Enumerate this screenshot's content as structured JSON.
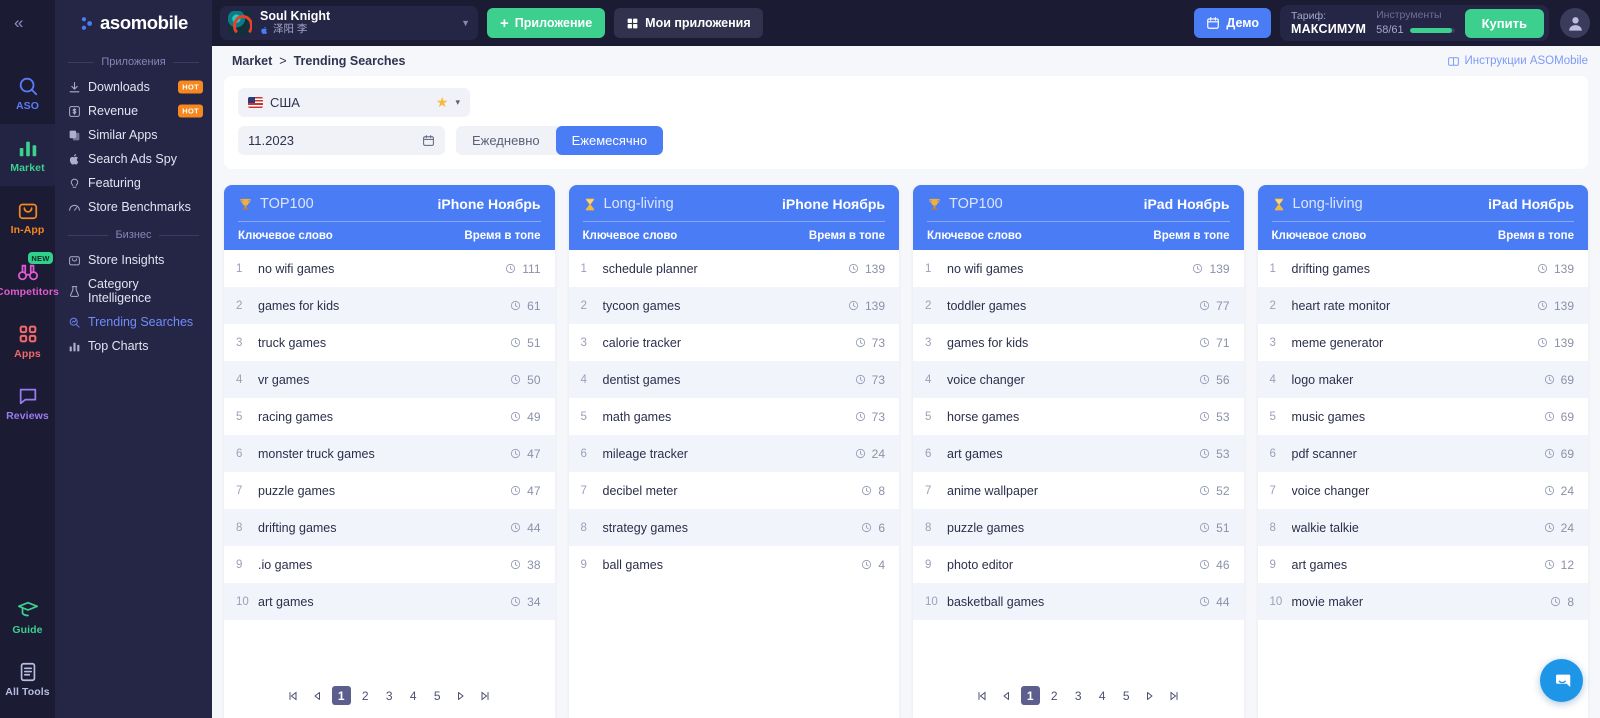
{
  "rail": {
    "collapse_icon": "chevron-double-left",
    "items": [
      {
        "label": "ASO",
        "icon": "search-icon",
        "color": "#5b7cf5",
        "active": false
      },
      {
        "label": "Market",
        "icon": "bar-chart-icon",
        "color": "#3ccf8e",
        "active": true
      },
      {
        "label": "In-App",
        "icon": "bag-icon",
        "color": "#f7881f",
        "active": false
      },
      {
        "label": "Competitors",
        "icon": "binoculars-icon",
        "color": "#e05bd0",
        "active": false,
        "badge": "NEW"
      },
      {
        "label": "Apps",
        "icon": "grid-icon",
        "color": "#f26a6a",
        "active": false
      },
      {
        "label": "Reviews",
        "icon": "chat-icon",
        "color": "#9a7bf0",
        "active": false
      }
    ],
    "bottom_items": [
      {
        "label": "Guide",
        "icon": "graduation-cap-icon",
        "color": "#3ccf8e"
      },
      {
        "label": "All Tools",
        "icon": "document-icon",
        "color": "#b9bee0"
      }
    ]
  },
  "sidebar": {
    "brand": "asomobile",
    "group1_label": "Приложения",
    "group1": [
      {
        "label": "Downloads",
        "icon": "download-icon",
        "badge": "HOT",
        "active": false
      },
      {
        "label": "Revenue",
        "icon": "dollar-icon",
        "badge": "HOT",
        "active": false
      },
      {
        "label": "Similar Apps",
        "icon": "copy-icon",
        "active": false
      },
      {
        "label": "Search Ads Spy",
        "icon": "apple-icon",
        "active": false
      },
      {
        "label": "Featuring",
        "icon": "lightbulb-icon",
        "active": false
      },
      {
        "label": "Store Benchmarks",
        "icon": "speedometer-icon",
        "active": false
      }
    ],
    "group2_label": "Бизнес",
    "group2": [
      {
        "label": "Store Insights",
        "icon": "store-icon",
        "active": false
      },
      {
        "label": "Category Intelligence",
        "icon": "flask-icon",
        "active": false
      },
      {
        "label": "Trending Searches",
        "icon": "search-trend-icon",
        "active": true
      },
      {
        "label": "Top Charts",
        "icon": "bar-chart-icon",
        "active": false
      }
    ]
  },
  "topbar": {
    "app_name": "Soul Knight",
    "app_developer": "泽阳 李",
    "app_platform_icon": "apple-icon",
    "add_app_label": "Приложение",
    "add_app_icon": "plus-icon",
    "my_apps_label": "Мои приложения",
    "my_apps_icon": "grid-icon",
    "demo_label": "Демо",
    "demo_icon": "calendar-icon",
    "plan_title": "Тариф:",
    "plan_value": "МАКСИМУМ",
    "tools_title": "Инструменты",
    "tools_value": "58/61",
    "tools_percent": 95,
    "buy_label": "Купить",
    "avatar_icon": "user-icon",
    "accent_green": "#3ccf8e",
    "accent_blue": "#4a7cf5"
  },
  "breadcrumb": {
    "root": "Market",
    "separator": ">",
    "current": "Trending Searches",
    "instructions_label": "Инструкции ASOMobile",
    "instructions_icon": "book-icon"
  },
  "filters": {
    "country": "США",
    "country_flag_icon": "us-flag-icon",
    "favorite_icon": "star-icon",
    "dropdown_icon": "chevron-down-icon",
    "date_value": "11.2023",
    "date_icon": "calendar-icon",
    "period_daily": "Ежедневно",
    "period_monthly": "Ежемесячно",
    "period_selected": "Ежемесячно"
  },
  "table_columns": {
    "keyword": "Ключевое слово",
    "time": "Время в топе"
  },
  "cards": [
    {
      "title": "TOP100",
      "title_icon": "trophy-icon",
      "device": "iPhone Ноябрь",
      "has_pager": true,
      "rows": [
        {
          "rank": "1",
          "keyword": "no wifi games",
          "time": "111"
        },
        {
          "rank": "2",
          "keyword": "games for kids",
          "time": "61"
        },
        {
          "rank": "3",
          "keyword": "truck games",
          "time": "51"
        },
        {
          "rank": "4",
          "keyword": "vr games",
          "time": "50"
        },
        {
          "rank": "5",
          "keyword": "racing games",
          "time": "49"
        },
        {
          "rank": "6",
          "keyword": "monster truck games",
          "time": "47"
        },
        {
          "rank": "7",
          "keyword": "puzzle games",
          "time": "47"
        },
        {
          "rank": "8",
          "keyword": "drifting games",
          "time": "44"
        },
        {
          "rank": "9",
          "keyword": ".io games",
          "time": "38"
        },
        {
          "rank": "10",
          "keyword": "art games",
          "time": "34"
        }
      ]
    },
    {
      "title": "Long-living",
      "title_icon": "hourglass-icon",
      "device": "iPhone Ноябрь",
      "has_pager": false,
      "rows": [
        {
          "rank": "1",
          "keyword": "schedule planner",
          "time": "139"
        },
        {
          "rank": "2",
          "keyword": "tycoon games",
          "time": "139"
        },
        {
          "rank": "3",
          "keyword": "calorie tracker",
          "time": "73"
        },
        {
          "rank": "4",
          "keyword": "dentist games",
          "time": "73"
        },
        {
          "rank": "5",
          "keyword": "math games",
          "time": "73"
        },
        {
          "rank": "6",
          "keyword": "mileage tracker",
          "time": "24"
        },
        {
          "rank": "7",
          "keyword": "decibel meter",
          "time": "8"
        },
        {
          "rank": "8",
          "keyword": "strategy games",
          "time": "6"
        },
        {
          "rank": "9",
          "keyword": "ball games",
          "time": "4"
        }
      ]
    },
    {
      "title": "TOP100",
      "title_icon": "trophy-icon",
      "device": "iPad Ноябрь",
      "has_pager": true,
      "rows": [
        {
          "rank": "1",
          "keyword": "no wifi games",
          "time": "139"
        },
        {
          "rank": "2",
          "keyword": "toddler games",
          "time": "77"
        },
        {
          "rank": "3",
          "keyword": "games for kids",
          "time": "71"
        },
        {
          "rank": "4",
          "keyword": "voice changer",
          "time": "56"
        },
        {
          "rank": "5",
          "keyword": "horse games",
          "time": "53"
        },
        {
          "rank": "6",
          "keyword": "art games",
          "time": "53"
        },
        {
          "rank": "7",
          "keyword": "anime wallpaper",
          "time": "52"
        },
        {
          "rank": "8",
          "keyword": "puzzle games",
          "time": "51"
        },
        {
          "rank": "9",
          "keyword": "photo editor",
          "time": "46"
        },
        {
          "rank": "10",
          "keyword": "basketball games",
          "time": "44"
        }
      ]
    },
    {
      "title": "Long-living",
      "title_icon": "hourglass-icon",
      "device": "iPad Ноябрь",
      "has_pager": false,
      "rows": [
        {
          "rank": "1",
          "keyword": "drifting games",
          "time": "139"
        },
        {
          "rank": "2",
          "keyword": "heart rate monitor",
          "time": "139"
        },
        {
          "rank": "3",
          "keyword": "meme generator",
          "time": "139"
        },
        {
          "rank": "4",
          "keyword": "logo maker",
          "time": "69"
        },
        {
          "rank": "5",
          "keyword": "music games",
          "time": "69"
        },
        {
          "rank": "6",
          "keyword": "pdf scanner",
          "time": "69"
        },
        {
          "rank": "7",
          "keyword": "voice changer",
          "time": "24"
        },
        {
          "rank": "8",
          "keyword": "walkie talkie",
          "time": "24"
        },
        {
          "rank": "9",
          "keyword": "art games",
          "time": "12"
        },
        {
          "rank": "10",
          "keyword": "movie maker",
          "time": "8"
        }
      ]
    }
  ],
  "pager": {
    "first_icon": "first-page-icon",
    "prev_icon": "prev-page-icon",
    "pages": [
      "1",
      "2",
      "3",
      "4",
      "5"
    ],
    "current_page": "1",
    "next_icon": "next-page-icon",
    "last_icon": "last-page-icon"
  },
  "chat_widget": {
    "icon": "chat-bubble-icon",
    "color": "#1e96e8"
  }
}
